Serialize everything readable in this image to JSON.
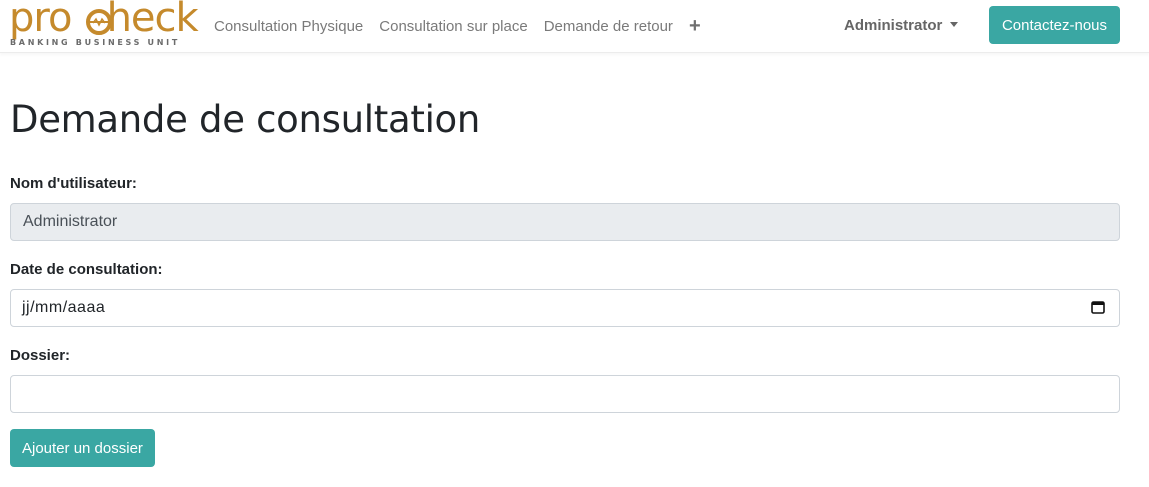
{
  "brand": {
    "name": "procheck",
    "tagline": "BANKING BUSINESS UNIT",
    "color": "#c58a2c"
  },
  "nav": {
    "links": [
      "Consultation Physique",
      "Consultation sur place",
      "Demande de retour"
    ],
    "plus_icon": "+",
    "user_menu": "Administrator",
    "contact_button": "Contactez-nous"
  },
  "form": {
    "title": "Demande de consultation",
    "username_label": "Nom d'utilisateur:",
    "username_value": "Administrator",
    "date_label": "Date de consultation:",
    "date_placeholder": "jj/mm/aaaa",
    "folder_label": "Dossier:",
    "folder_value": "",
    "add_button": "Ajouter un dossier"
  },
  "colors": {
    "accent": "#3aa7a3",
    "readonly_bg": "#e9ecef"
  }
}
